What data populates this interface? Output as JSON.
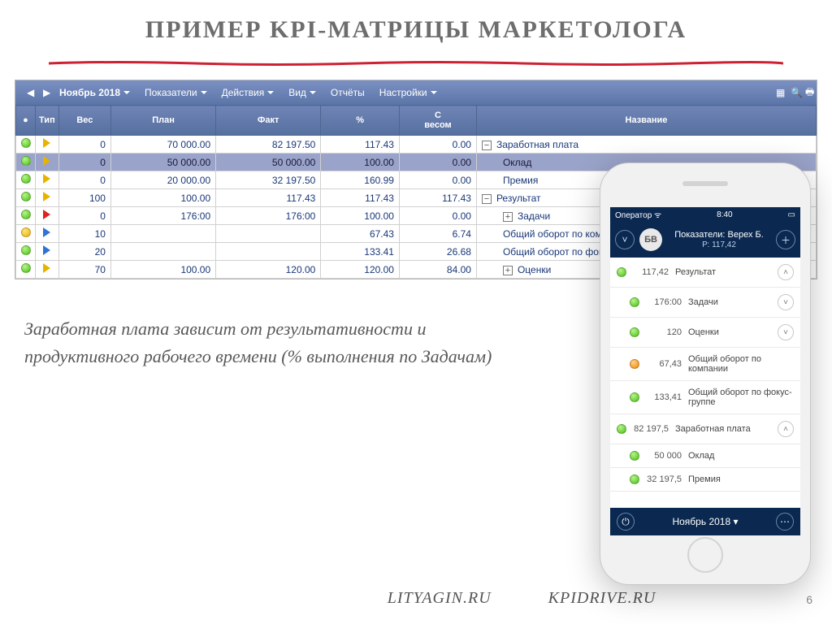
{
  "slide": {
    "title": "ПРИМЕР KPI-МАТРИЦЫ МАРКЕТОЛОГА",
    "caption": "Заработная плата зависит от результативности и продуктивного рабочего времени (% выполнения по Задачам)",
    "footer_left": "LITYAGIN.RU",
    "footer_right": "KPIDRIVE.RU",
    "page": "6"
  },
  "toolbar": {
    "nav_prev": "◀",
    "nav_next": "▶",
    "date": "Ноябрь 2018",
    "menus": [
      "Показатели",
      "Действия",
      "Вид",
      "Отчёты",
      "Настройки"
    ],
    "right_icons": [
      "grid-icon",
      "search-icon",
      "print-icon"
    ]
  },
  "table": {
    "headers": {
      "status": "",
      "type": "Тип",
      "weight": "Вес",
      "plan": "План",
      "fact": "Факт",
      "pct": "%",
      "weighted": "С\nвесом",
      "name": "Название"
    },
    "rows": [
      {
        "status": "green",
        "type": "yellow",
        "weight": "0",
        "plan": "70 000.00",
        "fact": "82 197.50",
        "pct": "117.43",
        "weighted": "0.00",
        "toggle": "minus",
        "indent": 0,
        "name": "Заработная плата",
        "sel": false
      },
      {
        "status": "green",
        "type": "yellow",
        "weight": "0",
        "plan": "50 000.00",
        "fact": "50 000.00",
        "pct": "100.00",
        "weighted": "0.00",
        "toggle": "",
        "indent": 1,
        "name": "Оклад",
        "sel": true
      },
      {
        "status": "green",
        "type": "yellow",
        "weight": "0",
        "plan": "20 000.00",
        "fact": "32 197.50",
        "pct": "160.99",
        "weighted": "0.00",
        "toggle": "",
        "indent": 1,
        "name": "Премия",
        "sel": false
      },
      {
        "status": "green",
        "type": "yellow",
        "weight": "100",
        "plan": "100.00",
        "fact": "117.43",
        "pct": "117.43",
        "weighted": "117.43",
        "toggle": "minus",
        "indent": 0,
        "name": "Результат",
        "sel": false
      },
      {
        "status": "green",
        "type": "red",
        "weight": "0",
        "plan": "176:00",
        "fact": "176:00",
        "pct": "100.00",
        "weighted": "0.00",
        "toggle": "plus",
        "indent": 1,
        "name": "Задачи",
        "sel": false
      },
      {
        "status": "yellow",
        "type": "blue",
        "weight": "10",
        "plan": "",
        "fact": "",
        "pct": "67.43",
        "weighted": "6.74",
        "toggle": "",
        "indent": 1,
        "name": "Общий оборот по компании",
        "sel": false
      },
      {
        "status": "green",
        "type": "blue",
        "weight": "20",
        "plan": "",
        "fact": "",
        "pct": "133.41",
        "weighted": "26.68",
        "toggle": "",
        "indent": 1,
        "name": "Общий оборот по фокус-группе",
        "sel": false
      },
      {
        "status": "green",
        "type": "yellow",
        "weight": "70",
        "plan": "100.00",
        "fact": "120.00",
        "pct": "120.00",
        "weighted": "84.00",
        "toggle": "plus",
        "indent": 1,
        "name": "Оценки",
        "sel": false
      }
    ]
  },
  "phone": {
    "statusbar": {
      "carrier": "Оператор",
      "time": "8:40"
    },
    "header": {
      "avatar": "БВ",
      "line1": "Показатели: Верех Б.",
      "line2": "Р: 117,42"
    },
    "items": [
      {
        "dot": "green",
        "val": "117,42",
        "lbl": "Результат",
        "chev": "up",
        "indent": 0
      },
      {
        "dot": "green",
        "val": "176:00",
        "lbl": "Задачи",
        "chev": "down",
        "indent": 1
      },
      {
        "dot": "green",
        "val": "120",
        "lbl": "Оценки",
        "chev": "down",
        "indent": 1
      },
      {
        "dot": "orange",
        "val": "67,43",
        "lbl": "Общий оборот по компании",
        "chev": "",
        "indent": 1
      },
      {
        "dot": "green",
        "val": "133,41",
        "lbl": "Общий оборот по фокус-группе",
        "chev": "",
        "indent": 1
      },
      {
        "dot": "green",
        "val": "82 197,5",
        "lbl": "Заработная плата",
        "chev": "up",
        "indent": 0
      },
      {
        "dot": "green",
        "val": "50 000",
        "lbl": "Оклад",
        "chev": "",
        "indent": 1
      },
      {
        "dot": "green",
        "val": "32 197,5",
        "lbl": "Премия",
        "chev": "",
        "indent": 1
      }
    ],
    "footer": {
      "date": "Ноябрь 2018",
      "down": "▾"
    }
  }
}
